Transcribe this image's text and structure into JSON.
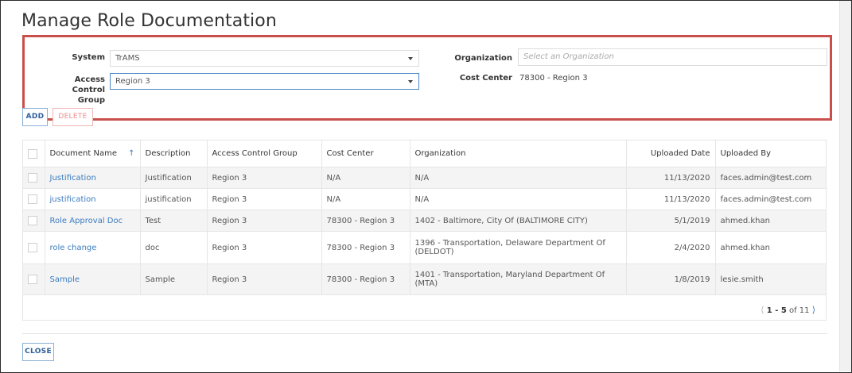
{
  "page": {
    "title": "Manage Role Documentation"
  },
  "filters": {
    "system_label": "System",
    "system_value": "TrAMS",
    "acg_label": "Access Control Group",
    "acg_value": "Region 3",
    "org_label": "Organization",
    "org_placeholder": "Select an Organization",
    "cost_center_label": "Cost Center",
    "cost_center_value": "78300 - Region 3"
  },
  "actions": {
    "add_label": "ADD",
    "delete_label": "DELETE",
    "close_label": "CLOSE"
  },
  "table": {
    "columns": [
      "Document Name",
      "Description",
      "Access Control Group",
      "Cost Center",
      "Organization",
      "Uploaded Date",
      "Uploaded By"
    ],
    "rows": [
      [
        "Justification",
        "Justification",
        "Region 3",
        "N/A",
        "N/A",
        "11/13/2020",
        "faces.admin@test.com"
      ],
      [
        "justification",
        "justification",
        "Region 3",
        "N/A",
        "N/A",
        "11/13/2020",
        "faces.admin@test.com"
      ],
      [
        "Role Approval Doc",
        "Test",
        "Region 3",
        "78300 - Region 3",
        "1402 - Baltimore, City Of (BALTIMORE CITY)",
        "5/1/2019",
        "ahmed.khan"
      ],
      [
        "role change",
        "doc",
        "Region 3",
        "78300 - Region 3",
        "1396 - Transportation, Delaware Department Of (DELDOT)",
        "2/4/2020",
        "ahmed.khan"
      ],
      [
        "Sample",
        "Sample",
        "Region 3",
        "78300 - Region 3",
        "1401 - Transportation, Maryland Department Of (MTA)",
        "1/8/2019",
        "lesie.smith"
      ]
    ]
  },
  "pagination": {
    "range": "1 - 5",
    "of_label": "of 11"
  },
  "colors": {
    "accent": "#3b7bbf",
    "highlight_border": "#c9504a"
  },
  "icons": {
    "sort": "arrow-up-icon",
    "prev": "chevron-left-icon",
    "next": "chevron-right-icon",
    "dropdown": "caret-down-icon"
  }
}
